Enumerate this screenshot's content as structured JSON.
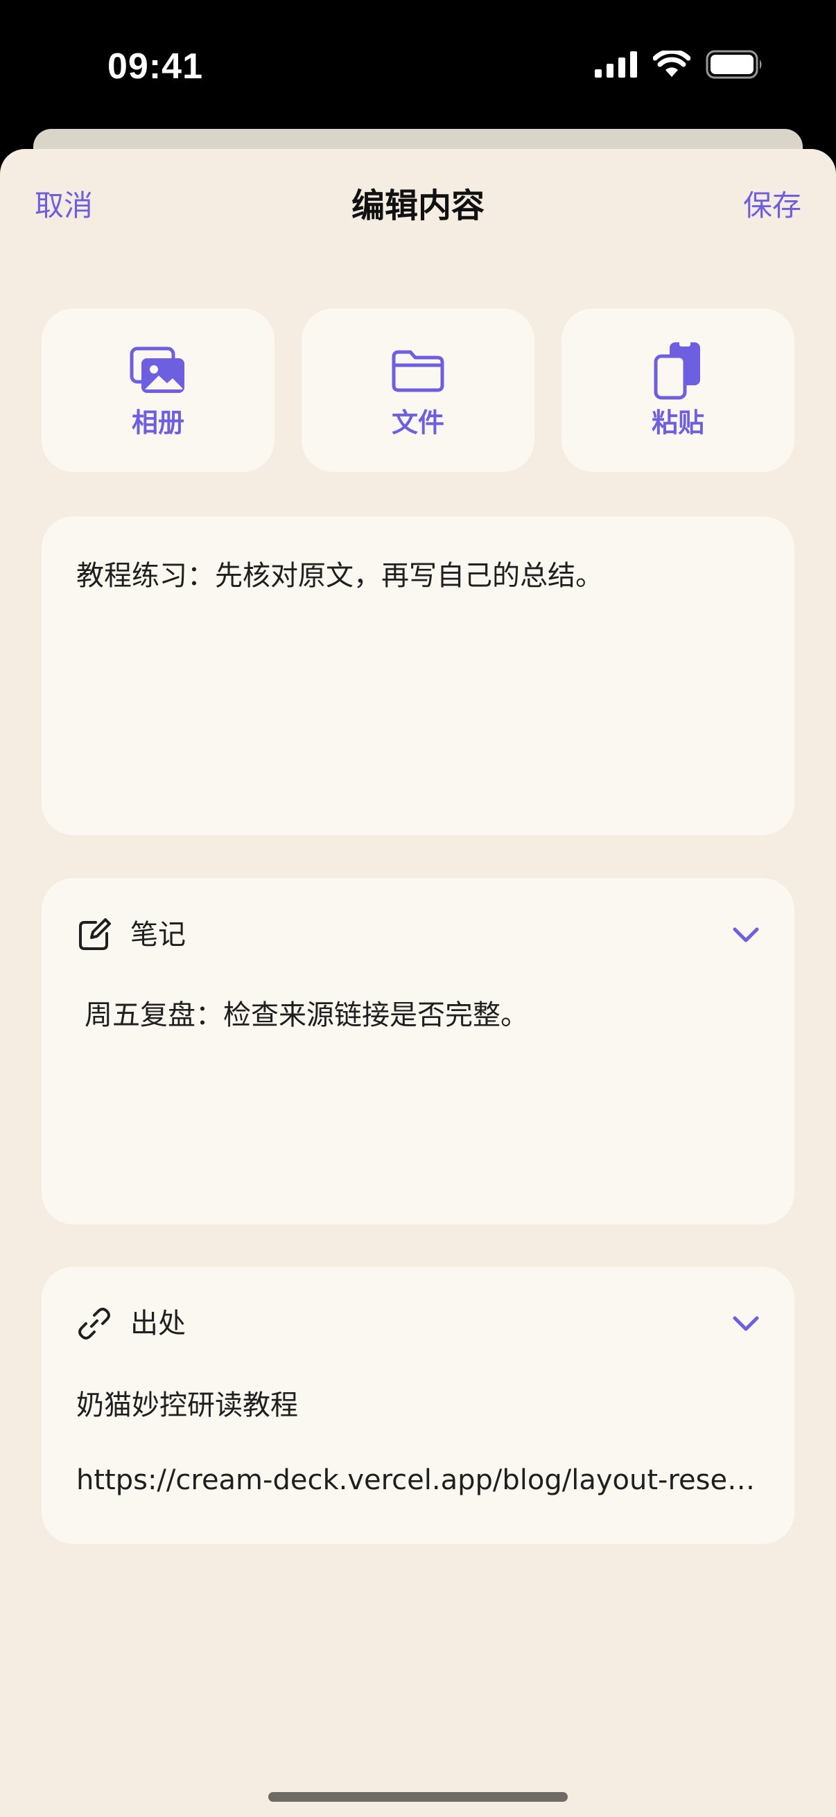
{
  "status_bar": {
    "time": "09:41"
  },
  "nav": {
    "cancel_label": "取消",
    "title": "编辑内容",
    "save_label": "保存"
  },
  "import_actions": [
    {
      "label": "相册",
      "icon": "photo-album-icon"
    },
    {
      "label": "文件",
      "icon": "folder-icon"
    },
    {
      "label": "粘贴",
      "icon": "paste-clipboard-icon"
    }
  ],
  "content": {
    "text": "教程练习：先核对原文，再写自己的总结。"
  },
  "notes": {
    "title": "笔记",
    "icon": "edit-note-icon",
    "text": "周五复盘：检查来源链接是否完整。"
  },
  "source": {
    "title": "出处",
    "icon": "link-icon",
    "name": "奶猫妙控研读教程",
    "url": "https://cream-deck.vercel.app/blog/layout-research"
  },
  "colors": {
    "accent": "#6d5fe0",
    "sheet_background": "#f5ede1",
    "card_background": "#fbf8f1",
    "text": "#1f1f1f"
  }
}
